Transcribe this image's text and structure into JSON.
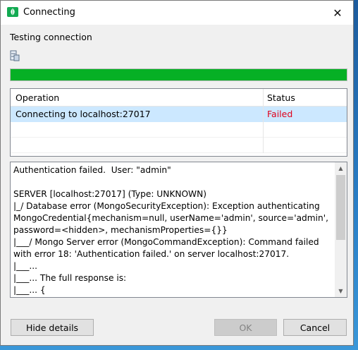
{
  "window": {
    "title": "Connecting",
    "close_glyph": "✕"
  },
  "heading": "Testing connection",
  "progress": {
    "fraction": 1.0,
    "color": "#06b025"
  },
  "table": {
    "columns": [
      "Operation",
      "Status"
    ],
    "rows": [
      {
        "operation": "Connecting to localhost:27017",
        "status": "Failed",
        "status_color": "#e0001a"
      },
      {
        "operation": "",
        "status": ""
      },
      {
        "operation": "",
        "status": ""
      }
    ]
  },
  "log": {
    "text": "Authentication failed.  User: \"admin\"\n\nSERVER [localhost:27017] (Type: UNKNOWN)\n|_/ Database error (MongoSecurityException): Exception authenticating MongoCredential{mechanism=null, userName='admin', source='admin', password=<hidden>, mechanismProperties={}}\n|___/ Mongo Server error (MongoCommandException): Command failed with error 18: 'Authentication failed.' on server localhost:27017.\n|___...\n|___... The full response is:\n|___... {"
  },
  "buttons": {
    "hide_details": "Hide details",
    "ok": "OK",
    "cancel": "Cancel"
  },
  "icons": {
    "app": "mongodb-leaf-icon",
    "database": "database-icon"
  }
}
